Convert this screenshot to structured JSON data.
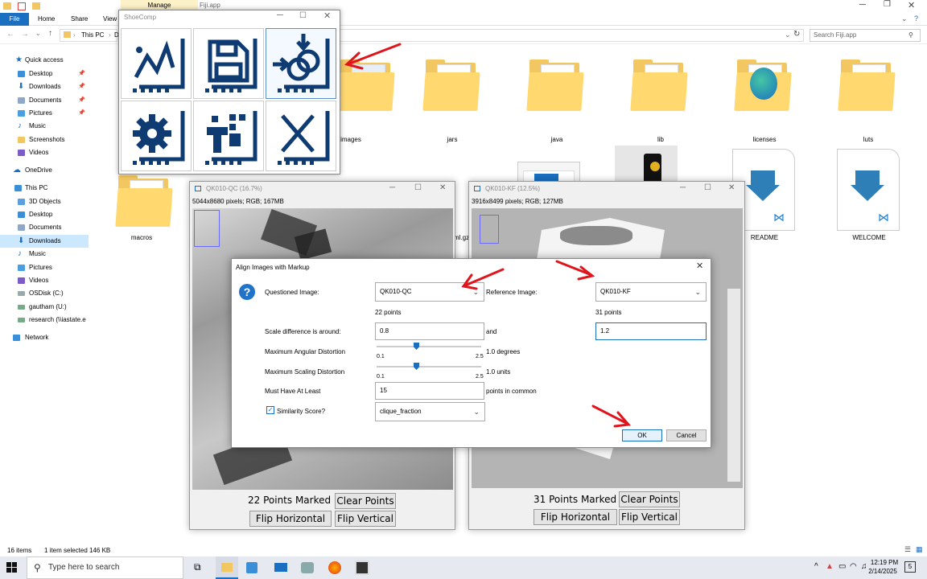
{
  "explorer": {
    "manage_label": "Manage",
    "window_title": "Fiji.app",
    "ribbon": {
      "file": "File",
      "home": "Home",
      "share": "Share",
      "view": "View"
    },
    "address": {
      "path_root": "This PC",
      "path_next": "D"
    },
    "search_placeholder": "Search Fiji.app",
    "nav": {
      "quick_access": "Quick access",
      "desktop": "Desktop",
      "downloads": "Downloads",
      "documents": "Documents",
      "pictures": "Pictures",
      "music": "Music",
      "screenshots": "Screenshots",
      "videos": "Videos",
      "onedrive": "OneDrive",
      "thispc": "This PC",
      "objects3d": "3D Objects",
      "desktop2": "Desktop",
      "documents2": "Documents",
      "downloads2": "Downloads",
      "music2": "Music",
      "pictures2": "Pictures",
      "videos2": "Videos",
      "osdisk": "OSDisk (C:)",
      "gautham": "gautham (U:)",
      "research": "research (\\\\iastate.e",
      "network": "Network"
    },
    "files": {
      "images": "images",
      "jars": "jars",
      "java": "java",
      "lib": "lib",
      "licenses": "licenses",
      "luts": "luts",
      "macros": "macros",
      "partial": "ml.gz",
      "readme": "README",
      "welcome": "WELCOME"
    },
    "status": {
      "items": "16 items",
      "selected": "1 item selected  146 KB"
    }
  },
  "shoecomp": {
    "title": "ShoeComp"
  },
  "qc_window": {
    "title": "QK010-QC (16.7%)",
    "info": "5044x8680 pixels; RGB; 167MB",
    "points_label": "22 Points Marked",
    "clear": "Clear Points",
    "flip_h": "Flip Horizontal",
    "flip_v": "Flip Vertical"
  },
  "kf_window": {
    "title": "QK010-KF (12.5%)",
    "info": "3916x8499 pixels; RGB; 127MB",
    "points_label": "31 Points Marked",
    "clear": "Clear Points",
    "flip_h": "Flip Horizontal",
    "flip_v": "Flip Vertical"
  },
  "dialog": {
    "title": "Align Images with Markup",
    "questioned_label": "Questioned Image:",
    "questioned_value": "QK010-QC",
    "questioned_points": "22 points",
    "reference_label": "Reference Image:",
    "reference_value": "QK010-KF",
    "reference_points": "31 points",
    "scale_label": "Scale difference is around:",
    "scale_low": "0.8",
    "and": "and",
    "scale_high": "1.2",
    "angular_label": "Maximum Angular Distortion",
    "angular_min": "0.1",
    "angular_max": "2.5",
    "angular_value": "1.0 degrees",
    "angular_level": 0.375,
    "scaling_label": "Maximum Scaling Distortion",
    "scaling_min": "0.1",
    "scaling_max": "2.5",
    "scaling_value": "1.0 units",
    "scaling_level": 0.375,
    "atleast_label": "Must Have At Least",
    "atleast_value": "15",
    "atleast_suffix": "points in common",
    "similarity_label": "Similarity Score?",
    "similarity_checked": true,
    "similarity_value": "clique_fraction",
    "ok": "OK",
    "cancel": "Cancel"
  },
  "taskbar": {
    "search_placeholder": "Type here to search",
    "time": "12:19 PM",
    "date": "2/14/2025",
    "notification_count": "5"
  },
  "colors": {
    "accent": "#1a6fc1",
    "folder": "#f2c660",
    "arrow": "#e0141b",
    "shoe_icon": "#0f3b73"
  }
}
